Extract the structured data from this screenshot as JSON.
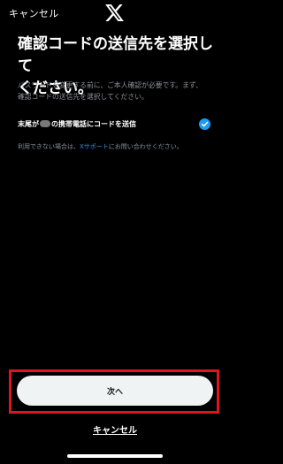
{
  "header": {
    "cancel_label": "キャンセル",
    "logo_icon": "x-logo-icon"
  },
  "main": {
    "title": "確認コードの送信先を選択して\nください。",
    "description": "パスワードを変更する前に、ご本人確認が必要です。まず、\n確認コードの送信先を選択してください。",
    "option": {
      "label_prefix": "末尾が",
      "label_suffix": "の携帯電話にコードを送信",
      "selected": true,
      "check_icon": "checkmark-circle-icon"
    },
    "help": {
      "text_before": "利用できない場合は、",
      "link": "Xサポート",
      "text_after": "にお問い合わせください。"
    }
  },
  "footer": {
    "next_label": "次へ",
    "cancel_label": "キャンセル"
  },
  "colors": {
    "background": "#000000",
    "accent": "#1d9bf0",
    "button_bg": "#eff3f4",
    "highlight": "#e0141b",
    "muted_text": "#8b8f94"
  }
}
